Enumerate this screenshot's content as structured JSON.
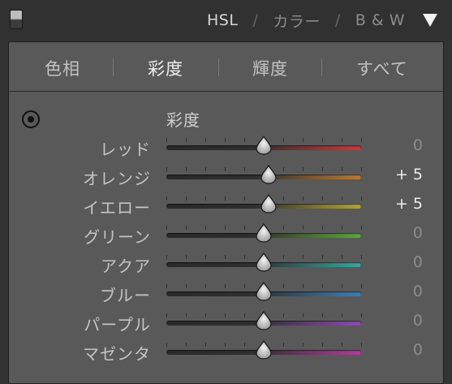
{
  "header": {
    "tabs": [
      "HSL",
      "カラー",
      "B & W"
    ],
    "separator": "/",
    "active_tab": 0
  },
  "subtabs": {
    "items": [
      "色相",
      "彩度",
      "輝度",
      "すべて"
    ],
    "active": 1
  },
  "section_title": "彩度",
  "sliders": [
    {
      "label": "レッド",
      "value": "0",
      "level": 0,
      "color": "#c23b3b"
    },
    {
      "label": "オレンジ",
      "value": "+ 5",
      "level": 5,
      "color": "#bb7a35"
    },
    {
      "label": "イエロー",
      "value": "+ 5",
      "level": 5,
      "color": "#b3a23a"
    },
    {
      "label": "グリーン",
      "value": "0",
      "level": 0,
      "color": "#5fa53b"
    },
    {
      "label": "アクア",
      "value": "0",
      "level": 0,
      "color": "#3aa5a0"
    },
    {
      "label": "ブルー",
      "value": "0",
      "level": 0,
      "color": "#3b80b8"
    },
    {
      "label": "パープル",
      "value": "0",
      "level": 0,
      "color": "#8d4bb0"
    },
    {
      "label": "マゼンタ",
      "value": "0",
      "level": 0,
      "color": "#b03d9a"
    }
  ],
  "slider_range": [
    -100,
    100
  ],
  "icons": {
    "panel_switch": "panel-toggle-icon",
    "collapse": "triangle-down-icon",
    "target": "target-adjust-icon"
  }
}
